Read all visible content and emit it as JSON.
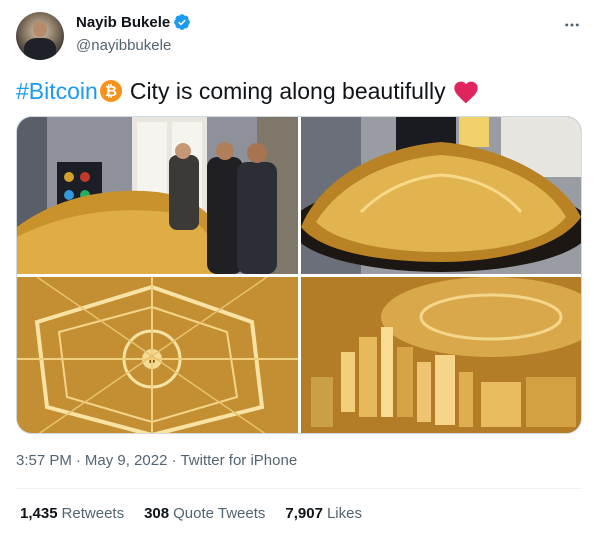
{
  "author": {
    "name": "Nayib Bukele",
    "handle": "@nayibbukele",
    "verified": true
  },
  "tweet": {
    "hashtag": "#Bitcoin",
    "text": "City is coming along beautifully",
    "emojis": [
      "bitcoin-icon",
      "red-heart-icon"
    ]
  },
  "media": {
    "count": 4,
    "images": [
      "gold-city-model-with-people",
      "gold-city-model-wide",
      "gold-city-model-top-view",
      "gold-city-model-closeup"
    ]
  },
  "meta": {
    "time": "3:57 PM",
    "separator1": "·",
    "date": "May 9, 2022",
    "separator2": "·",
    "source": "Twitter for iPhone"
  },
  "stats": {
    "retweets_count": "1,435",
    "retweets_label": "Retweets",
    "quotes_count": "308",
    "quotes_label": "Quote Tweets",
    "likes_count": "7,907",
    "likes_label": "Likes"
  },
  "colors": {
    "accent": "#1d9bf0",
    "text": "#0f1419",
    "secondary": "#536471",
    "heart": "#f91880",
    "bitcoin": "#f7931a"
  }
}
